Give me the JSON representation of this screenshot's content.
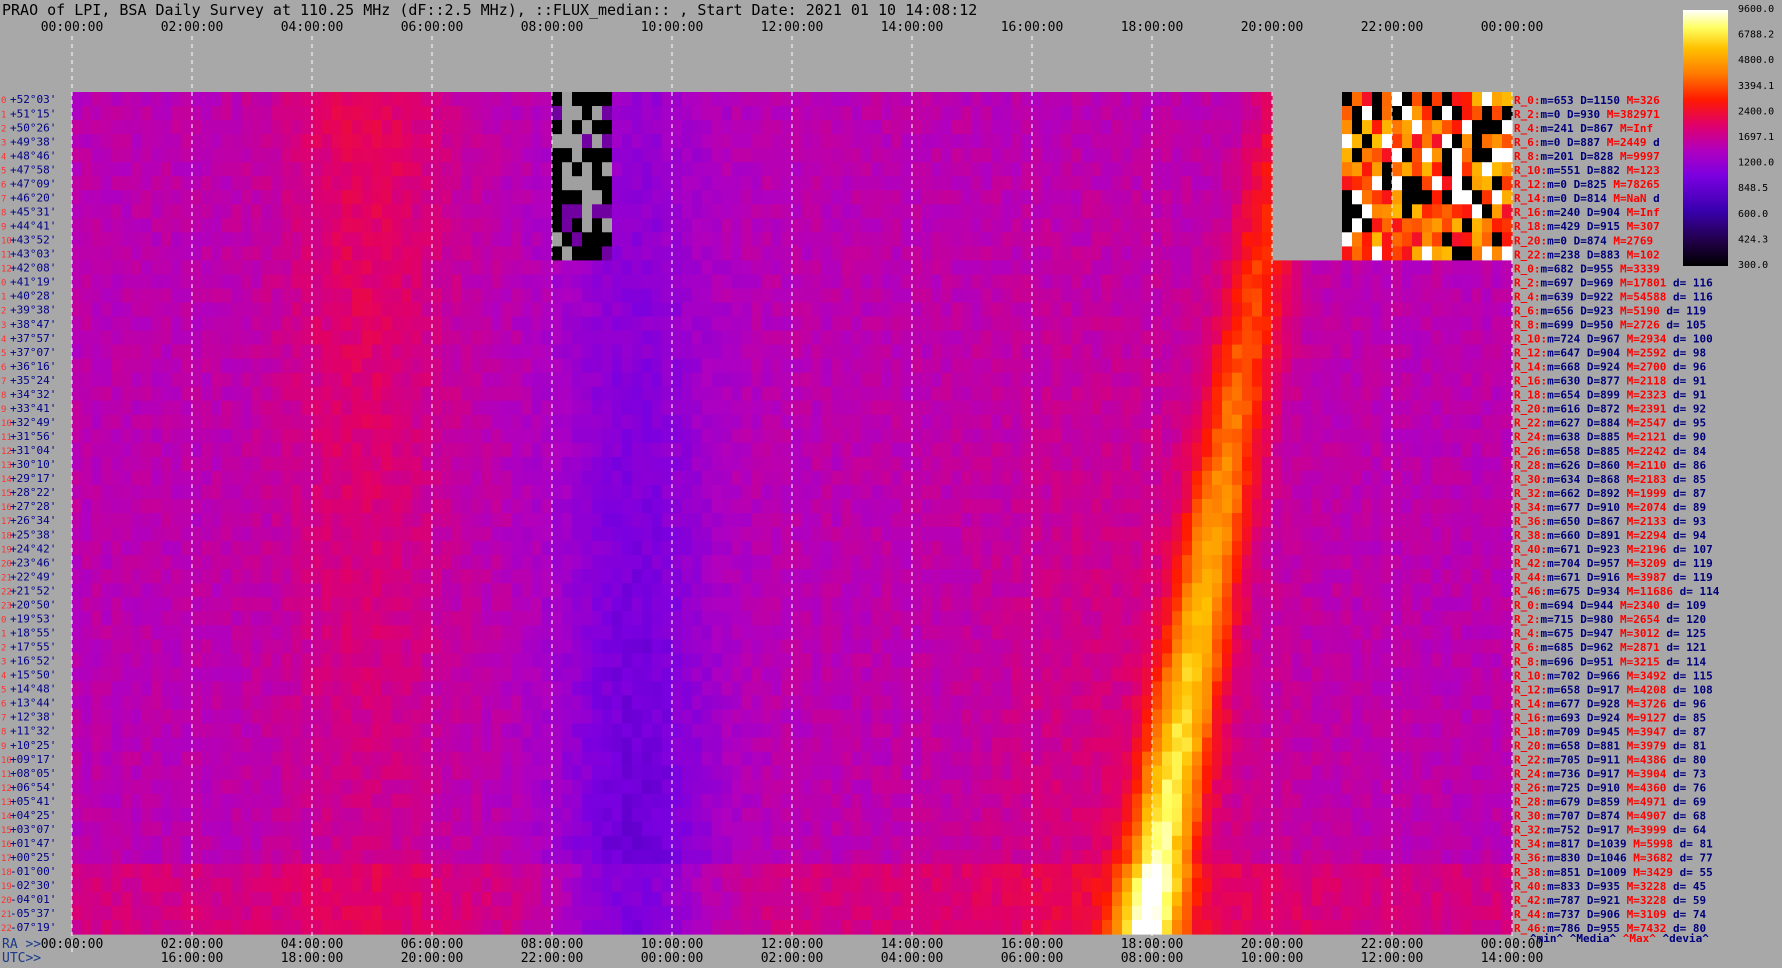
{
  "title": "PRAO of LPI, BSA Daily Survey at 110.25 MHz (dF::2.5 MHz), ::FLUX_median:: , Start Date: 2021 01 10 14:08:12",
  "colors": {
    "background": "#a8a8a8",
    "dec_label": "#000088",
    "row_index": "#ff3030",
    "stat_label_red": "#ff0000",
    "stat_text": "#00007a",
    "legend_min": "#00007a",
    "legend_median": "#00007a",
    "legend_max": "#ff0000",
    "legend_devia": "#00007a"
  },
  "chart_data": {
    "type": "heatmap",
    "x_unit": "hours (UTC / RA)",
    "xlim_hours": [
      0,
      24
    ],
    "top_axis_labels": [
      "00:00:00",
      "02:00:00",
      "04:00:00",
      "06:00:00",
      "08:00:00",
      "10:00:00",
      "12:00:00",
      "14:00:00",
      "16:00:00",
      "18:00:00",
      "20:00:00",
      "22:00:00",
      "00:00:00"
    ],
    "ra_axis_prefix": "RA >>",
    "utc_axis_prefix": "UTC>>",
    "ra_axis_labels": [
      "00:00:00",
      "02:00:00",
      "04:00:00",
      "06:00:00",
      "08:00:00",
      "10:00:00",
      "12:00:00",
      "14:00:00",
      "16:00:00",
      "18:00:00",
      "20:00:00",
      "22:00:00",
      "00:00:00"
    ],
    "utc_axis_labels": [
      "16:00:00",
      "18:00:00",
      "20:00:00",
      "22:00:00",
      "00:00:00",
      "02:00:00",
      "04:00:00",
      "06:00:00",
      "08:00:00",
      "10:00:00",
      "12:00:00",
      "14:00:00"
    ],
    "colorbar": {
      "ticks": [
        "9600.0",
        "6788.2",
        "4800.0",
        "3394.1",
        "2400.0",
        "1697.1",
        "1200.0",
        "848.5",
        "600.0",
        "424.3",
        "300.0"
      ],
      "min": 300,
      "max": 9600,
      "scale": "log"
    },
    "rows": [
      {
        "idx": "0",
        "dec": "+52°03'",
        "stat": [
          "R_0:",
          "m=653 D=1150",
          "M=326",
          ""
        ]
      },
      {
        "idx": "1",
        "dec": "+51°15'",
        "stat": [
          "R_2:",
          "m=0 D=930",
          "M=382971",
          ""
        ]
      },
      {
        "idx": "2",
        "dec": "+50°26'",
        "stat": [
          "R_4:",
          "m=241 D=867",
          "M=Inf",
          ""
        ]
      },
      {
        "idx": "3",
        "dec": "+49°38'",
        "stat": [
          "R_6:",
          "m=0 D=887",
          "M=2449",
          "d"
        ]
      },
      {
        "idx": "4",
        "dec": "+48°46'",
        "stat": [
          "R_8:",
          "m=201 D=828",
          "M=9997",
          ""
        ]
      },
      {
        "idx": "5",
        "dec": "+47°58'",
        "stat": [
          "R_10:",
          "m=551 D=882",
          "M=123",
          ""
        ]
      },
      {
        "idx": "6",
        "dec": "+47°09'",
        "stat": [
          "R_12:",
          "m=0 D=825",
          "M=78265",
          ""
        ]
      },
      {
        "idx": "7",
        "dec": "+46°20'",
        "stat": [
          "R_14:",
          "m=0 D=814",
          "M=NaN",
          "d"
        ]
      },
      {
        "idx": "8",
        "dec": "+45°31'",
        "stat": [
          "R_16:",
          "m=240 D=904",
          "M=Inf",
          ""
        ]
      },
      {
        "idx": "9",
        "dec": "+44°41'",
        "stat": [
          "R_18:",
          "m=429 D=915",
          "M=307",
          ""
        ]
      },
      {
        "idx": "10",
        "dec": "+43°52'",
        "stat": [
          "R_20:",
          "m=0 D=874",
          "M=2769",
          ""
        ]
      },
      {
        "idx": "11",
        "dec": "+43°03'",
        "stat": [
          "R_22:",
          "m=238 D=883",
          "M=102",
          ""
        ]
      },
      {
        "idx": "12",
        "dec": "+42°08'",
        "stat": [
          "R_0:",
          "m=682 D=955",
          "M=3339",
          ""
        ]
      },
      {
        "idx": "0",
        "dec": "+41°19'",
        "stat": [
          "R_2:",
          "m=697 D=969",
          "M=17801",
          "d= 116"
        ]
      },
      {
        "idx": "1",
        "dec": "+40°28'",
        "stat": [
          "R_4:",
          "m=639 D=922",
          "M=54588",
          "d= 116"
        ]
      },
      {
        "idx": "2",
        "dec": "+39°38'",
        "stat": [
          "R_6:",
          "m=656 D=923",
          "M=5190",
          "d= 119"
        ]
      },
      {
        "idx": "3",
        "dec": "+38°47'",
        "stat": [
          "R_8:",
          "m=699 D=950",
          "M=2726",
          "d= 105"
        ]
      },
      {
        "idx": "4",
        "dec": "+37°57'",
        "stat": [
          "R_10:",
          "m=724 D=967",
          "M=2934",
          "d= 100"
        ]
      },
      {
        "idx": "5",
        "dec": "+37°07'",
        "stat": [
          "R_12:",
          "m=647 D=904",
          "M=2592",
          "d= 98"
        ]
      },
      {
        "idx": "6",
        "dec": "+36°16'",
        "stat": [
          "R_14:",
          "m=668 D=924",
          "M=2700",
          "d= 96"
        ]
      },
      {
        "idx": "7",
        "dec": "+35°24'",
        "stat": [
          "R_16:",
          "m=630 D=877",
          "M=2118",
          "d= 91"
        ]
      },
      {
        "idx": "8",
        "dec": "+34°32'",
        "stat": [
          "R_18:",
          "m=654 D=899",
          "M=2323",
          "d= 91"
        ]
      },
      {
        "idx": "9",
        "dec": "+33°41'",
        "stat": [
          "R_20:",
          "m=616 D=872",
          "M=2391",
          "d= 92"
        ]
      },
      {
        "idx": "10",
        "dec": "+32°49'",
        "stat": [
          "R_22:",
          "m=627 D=884",
          "M=2547",
          "d= 95"
        ]
      },
      {
        "idx": "11",
        "dec": "+31°56'",
        "stat": [
          "R_24:",
          "m=638 D=885",
          "M=2121",
          "d= 90"
        ]
      },
      {
        "idx": "12",
        "dec": "+31°04'",
        "stat": [
          "R_26:",
          "m=658 D=885",
          "M=2242",
          "d= 84"
        ]
      },
      {
        "idx": "13",
        "dec": "+30°10'",
        "stat": [
          "R_28:",
          "m=626 D=860",
          "M=2110",
          "d= 86"
        ]
      },
      {
        "idx": "14",
        "dec": "+29°17'",
        "stat": [
          "R_30:",
          "m=634 D=868",
          "M=2183",
          "d= 85"
        ]
      },
      {
        "idx": "15",
        "dec": "+28°22'",
        "stat": [
          "R_32:",
          "m=662 D=892",
          "M=1999",
          "d= 87"
        ]
      },
      {
        "idx": "16",
        "dec": "+27°28'",
        "stat": [
          "R_34:",
          "m=677 D=910",
          "M=2074",
          "d= 89"
        ]
      },
      {
        "idx": "17",
        "dec": "+26°34'",
        "stat": [
          "R_36:",
          "m=650 D=867",
          "M=2133",
          "d= 93"
        ]
      },
      {
        "idx": "18",
        "dec": "+25°38'",
        "stat": [
          "R_38:",
          "m=660 D=891",
          "M=2294",
          "d= 94"
        ]
      },
      {
        "idx": "19",
        "dec": "+24°42'",
        "stat": [
          "R_40:",
          "m=671 D=923",
          "M=2196",
          "d= 107"
        ]
      },
      {
        "idx": "20",
        "dec": "+23°46'",
        "stat": [
          "R_42:",
          "m=704 D=957",
          "M=3209",
          "d= 119"
        ]
      },
      {
        "idx": "21",
        "dec": "+22°49'",
        "stat": [
          "R_44:",
          "m=671 D=916",
          "M=3987",
          "d= 119"
        ]
      },
      {
        "idx": "22",
        "dec": "+21°52'",
        "stat": [
          "R_46:",
          "m=675 D=934",
          "M=11686",
          "d= 114"
        ]
      },
      {
        "idx": "23",
        "dec": "+20°50'",
        "stat": [
          "R_0:",
          "m=694 D=944",
          "M=2340",
          "d= 109"
        ]
      },
      {
        "idx": "0",
        "dec": "+19°53'",
        "stat": [
          "R_2:",
          "m=715 D=980",
          "M=2654",
          "d= 120"
        ]
      },
      {
        "idx": "1",
        "dec": "+18°55'",
        "stat": [
          "R_4:",
          "m=675 D=947",
          "M=3012",
          "d= 125"
        ]
      },
      {
        "idx": "2",
        "dec": "+17°55'",
        "stat": [
          "R_6:",
          "m=685 D=962",
          "M=2871",
          "d= 121"
        ]
      },
      {
        "idx": "3",
        "dec": "+16°52'",
        "stat": [
          "R_8:",
          "m=696 D=951",
          "M=3215",
          "d= 114"
        ]
      },
      {
        "idx": "4",
        "dec": "+15°50'",
        "stat": [
          "R_10:",
          "m=702 D=966",
          "M=3492",
          "d= 115"
        ]
      },
      {
        "idx": "5",
        "dec": "+14°48'",
        "stat": [
          "R_12:",
          "m=658 D=917",
          "M=4208",
          "d= 108"
        ]
      },
      {
        "idx": "6",
        "dec": "+13°44'",
        "stat": [
          "R_14:",
          "m=677 D=928",
          "M=3726",
          "d= 96"
        ]
      },
      {
        "idx": "7",
        "dec": "+12°38'",
        "stat": [
          "R_16:",
          "m=693 D=924",
          "M=9127",
          "d= 85"
        ]
      },
      {
        "idx": "8",
        "dec": "+11°32'",
        "stat": [
          "R_18:",
          "m=709 D=945",
          "M=3947",
          "d= 87"
        ]
      },
      {
        "idx": "9",
        "dec": "+10°25'",
        "stat": [
          "R_20:",
          "m=658 D=881",
          "M=3979",
          "d= 81"
        ]
      },
      {
        "idx": "10",
        "dec": "+09°17'",
        "stat": [
          "R_22:",
          "m=705 D=911",
          "M=4386",
          "d= 80"
        ]
      },
      {
        "idx": "11",
        "dec": "+08°05'",
        "stat": [
          "R_24:",
          "m=736 D=917",
          "M=3904",
          "d= 73"
        ]
      },
      {
        "idx": "12",
        "dec": "+06°54'",
        "stat": [
          "R_26:",
          "m=725 D=910",
          "M=4360",
          "d= 76"
        ]
      },
      {
        "idx": "13",
        "dec": "+05°41'",
        "stat": [
          "R_28:",
          "m=679 D=859",
          "M=4971",
          "d= 69"
        ]
      },
      {
        "idx": "14",
        "dec": "+04°25'",
        "stat": [
          "R_30:",
          "m=707 D=874",
          "M=4907",
          "d= 68"
        ]
      },
      {
        "idx": "15",
        "dec": "+03°07'",
        "stat": [
          "R_32:",
          "m=752 D=917",
          "M=3999",
          "d= 64"
        ]
      },
      {
        "idx": "16",
        "dec": "+01°47'",
        "stat": [
          "R_34:",
          "m=817 D=1039",
          "M=5998",
          "d= 81"
        ]
      },
      {
        "idx": "17",
        "dec": "+00°25'",
        "stat": [
          "R_36:",
          "m=830 D=1046",
          "M=3682",
          "d= 77"
        ]
      },
      {
        "idx": "18",
        "dec": "-01°00'",
        "stat": [
          "R_38:",
          "m=851 D=1009",
          "M=3429",
          "d= 55"
        ]
      },
      {
        "idx": "19",
        "dec": "-02°30'",
        "stat": [
          "R_40:",
          "m=833 D=935",
          "M=3228",
          "d= 45"
        ]
      },
      {
        "idx": "20",
        "dec": "-04°01'",
        "stat": [
          "R_42:",
          "m=787 D=921",
          "M=3228",
          "d= 59"
        ]
      },
      {
        "idx": "21",
        "dec": "-05°37'",
        "stat": [
          "R_44:",
          "m=737 D=906",
          "M=3109",
          "d= 74"
        ]
      },
      {
        "idx": "22",
        "dec": "-07°19'",
        "stat": [
          "R_46:",
          "m=786 D=955",
          "M=7432",
          "d= 80"
        ]
      }
    ],
    "legend": {
      "min": "^min^",
      "median": "^Media^",
      "max": "^Max^",
      "devia": "^devia^"
    }
  }
}
